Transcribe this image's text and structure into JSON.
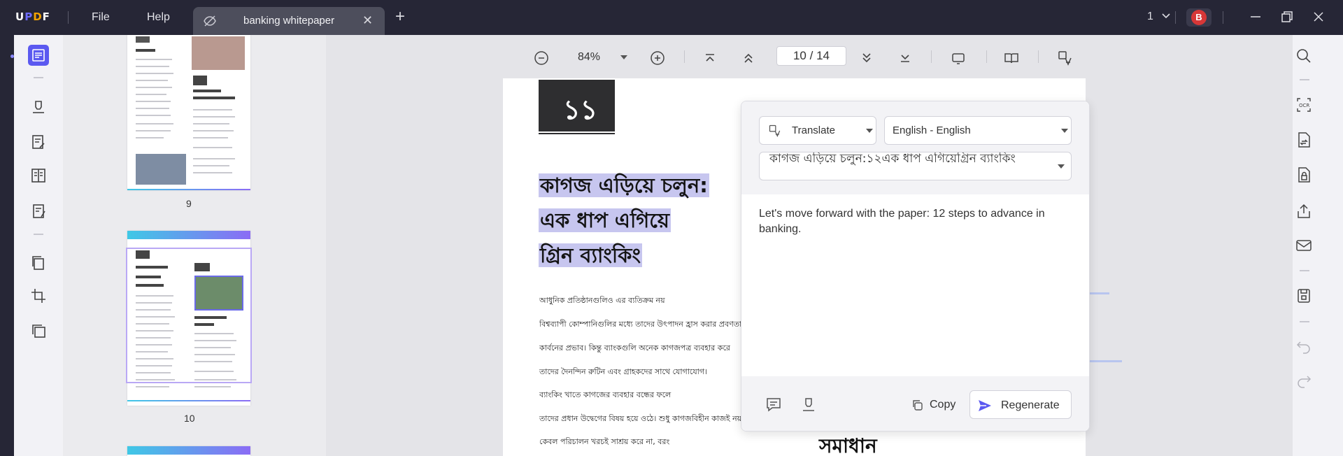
{
  "app": {
    "logo": "UPDF",
    "menu": [
      "File",
      "Help"
    ]
  },
  "tab": {
    "title": "banking whitepaper"
  },
  "titlebar": {
    "page_indicator": "1"
  },
  "user": {
    "initial": "B"
  },
  "toolbar": {
    "zoom": "84%",
    "current_page": "10",
    "total_pages": "14",
    "page_sep": "/"
  },
  "thumbnails": [
    {
      "label": "9"
    },
    {
      "label": "10"
    }
  ],
  "document": {
    "section_number": "১১",
    "heading_lines": [
      "কাগজ এড়িয়ে চলুন:",
      "এক ধাপ এগিয়ে",
      "গ্রিন ব্যাংকিং"
    ],
    "body_lines": [
      "আধুনিক প্রতিষ্ঠানগুলিও এর ব্যতিক্রম নয়",
      "বিশ্বব্যাপী কোম্পানিগুলির মধ্যে তাদের উৎপাদন হ্রাস করার প্রবণতা",
      "কার্বনের প্রভাব। কিন্তু ব্যাংকগুলি অনেক কাগজপত্র ব্যবহার করে",
      "তাদের দৈনন্দিন রুটিন এবং গ্রাহকদের সাথে যোগাযোগ।",
      "ব্যাংকিং খাতে কাগজের ব্যবহার বন্ধের ফলে",
      "তাদের প্রধান উদ্বেগের বিষয় হয়ে ওঠে। শুধু কাগজবিহীন কাজই নয়,",
      "কেবল পরিচালন খরচই সাশ্রয় করে না, বরং"
    ],
    "right_heading": "সমাধান"
  },
  "translate_popup": {
    "mode": "Translate",
    "language": "English - English",
    "source_text": "কাগজ এড়িয়ে চলুন:১২এক ধাপ এগিয়েগ্রিন ব্যাংকিং",
    "result": "Let's move forward with the paper: 12 steps to advance in banking.",
    "copy_label": "Copy",
    "regenerate_label": "Regenerate"
  },
  "colors": {
    "accent": "#5b59f0",
    "highlight": "#c7c6ef",
    "avatar": "#d73737",
    "titlebar": "#262636"
  }
}
